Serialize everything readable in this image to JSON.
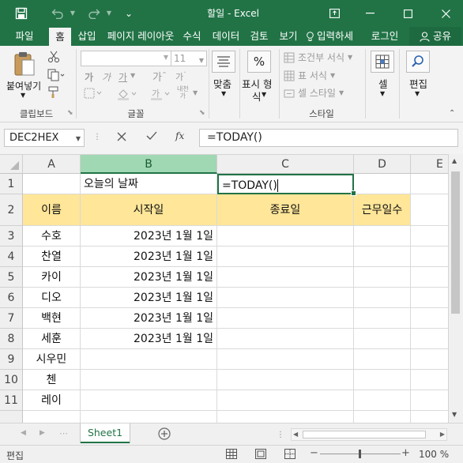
{
  "window": {
    "title": "할일 - Excel"
  },
  "tabs": [
    "파일",
    "홈",
    "삽입",
    "페이지 레이아웃",
    "수식",
    "데이터",
    "검토",
    "보기"
  ],
  "tell_me": "입력하세",
  "login": "로그인",
  "share": "공유",
  "ribbon": {
    "paste_label": "붙여넣기",
    "font_size": "11",
    "wrap_label": "맞춤",
    "number_label_1": "표시 형",
    "number_label_2": "식",
    "cond_format": "조건부 서식",
    "table_format": "표 서식",
    "cell_style": "셀 스타일",
    "cells_label": "셀",
    "edit_label": "편집",
    "groups": {
      "clipboard": "클립보드",
      "font": "글꼴",
      "style": "스타일"
    }
  },
  "formula_bar": {
    "name_box": "DEC2HEX",
    "formula": "=TODAY()",
    "fx": "fx"
  },
  "columns": [
    "A",
    "B",
    "C",
    "D",
    "E"
  ],
  "rows": [
    "1",
    "2",
    "3",
    "4",
    "5",
    "6",
    "7",
    "8",
    "9",
    "10",
    "11"
  ],
  "cells": {
    "B1": "오늘의 날짜",
    "C1": "=TODAY()",
    "A2": "이름",
    "B2": "시작일",
    "C2": "종료일",
    "D2": "근무일수",
    "A3": "수호",
    "B3": "2023년 1월 1일",
    "A4": "찬열",
    "B4": "2023년 1월 1일",
    "A5": "카이",
    "B5": "2023년 1월 1일",
    "A6": "디오",
    "B6": "2023년 1월 1일",
    "A7": "백현",
    "B7": "2023년 1월 1일",
    "A8": "세훈",
    "B8": "2023년 1월 1일",
    "A9": "시우민",
    "A10": "첸",
    "A11": "레이"
  },
  "sheet_tab": "Sheet1",
  "status": {
    "mode": "편집",
    "zoom": "100 %"
  },
  "colors": {
    "excel_green": "#217346",
    "header_fill": "#ffe699",
    "selected_col": "#a0d8b3"
  }
}
